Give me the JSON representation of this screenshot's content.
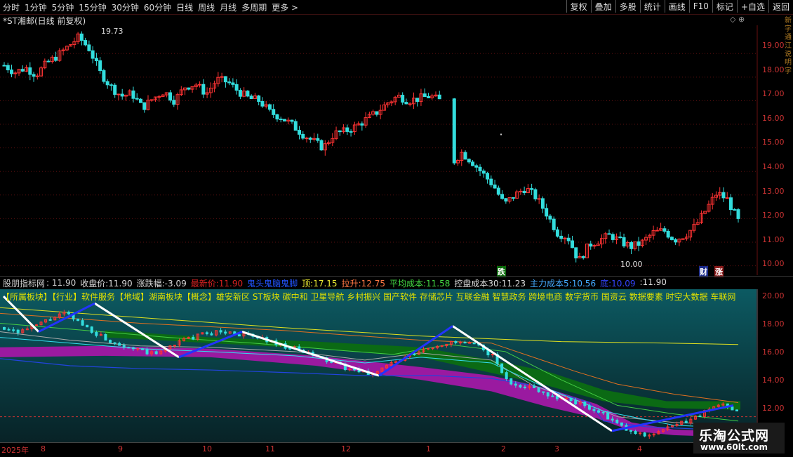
{
  "toolbar": {
    "periods": [
      "分时",
      "1分钟",
      "5分钟",
      "15分钟",
      "30分钟",
      "60分钟",
      "日线",
      "周线",
      "月线",
      "多周期",
      "更多 >"
    ],
    "active_period": "日线",
    "tools": [
      "复权",
      "叠加",
      "多股",
      "统计",
      "画线",
      "F10",
      "标记",
      "+自选",
      "返回"
    ]
  },
  "main_chart": {
    "title": "*ST湘邮(日线 前复权)",
    "high_label": "19.73",
    "low_label": "10.00",
    "y_ticks": [
      "19.00",
      "18.00",
      "17.00",
      "16.00",
      "15.00",
      "14.00",
      "13.00",
      "12.00",
      "11.00",
      "10.00"
    ],
    "markers": {
      "die": "跌",
      "cai": "财",
      "zhang": "涨"
    },
    "side_text": "新 字 通 江 说 明 字"
  },
  "indicator": {
    "name": "股朋指标网",
    "value": "11.90",
    "fields": [
      {
        "label": "收盘价:",
        "value": "11.90",
        "color": "#dddddd"
      },
      {
        "label": "涨跌幅:",
        "value": "-3.09",
        "color": "#dddddd"
      },
      {
        "label": "最新价:",
        "value": "11.90",
        "color": "#dd2222"
      },
      {
        "label": "鬼头鬼脑鬼脚",
        "value": "",
        "color": "#2255ff"
      },
      {
        "label": "顶:",
        "value": "17.15",
        "color": "#eeee33"
      },
      {
        "label": "拉升:",
        "value": "12.75",
        "color": "#ff7744"
      },
      {
        "label": "平均成本:",
        "value": "11.58",
        "color": "#44dd44"
      },
      {
        "label": "控盘成本30:",
        "value": "11.23",
        "color": "#dddddd"
      },
      {
        "label": "主力成本5:",
        "value": "10.56",
        "color": "#44aaff"
      },
      {
        "label": "底:",
        "value": "10.09",
        "color": "#3344ff"
      },
      {
        "label": ":",
        "value": "11.90",
        "color": "#dddddd"
      }
    ],
    "concepts": "【所属板块】【行业】软件服务【地域】湖南板块【概念】雄安新区 ST板块 碳中和 卫星导航 乡村振兴 国产软件 存储芯片 互联金融 智慧政务 跨境电商 数字货币 国资云 数据要素 时空大数据 车联网",
    "y_ticks": [
      "20.00",
      "18.00",
      "16.00",
      "14.00",
      "12.00"
    ]
  },
  "x_axis": [
    "2025年",
    "8",
    "9",
    "10",
    "11",
    "12",
    "1",
    "2",
    "3",
    "4"
  ],
  "brand": {
    "name": "乐淘公式网",
    "url": "www.60lt.com"
  },
  "chart_data": {
    "type": "candlestick",
    "title": "*ST湘邮(日线 前复权)",
    "ylim": [
      9.6,
      20.2
    ],
    "annotations": [
      {
        "label": "19.73"
      },
      {
        "label": "10.00"
      }
    ],
    "close_path": [
      18.5,
      18.2,
      18.4,
      18.1,
      18.6,
      18.9,
      19.3,
      19.7,
      19.2,
      18.2,
      17.6,
      17.2,
      17.3,
      16.7,
      17.1,
      17.4,
      17.0,
      17.6,
      17.7,
      17.3,
      17.9,
      17.8,
      17.4,
      17.1,
      17.0,
      16.5,
      16.3,
      16.0,
      15.6,
      15.3,
      15.0,
      15.6,
      15.7,
      15.9,
      16.2,
      16.5,
      16.9,
      17.2,
      17.0,
      17.1,
      17.2,
      17.0,
      14.3,
      14.8,
      14.4,
      13.9,
      13.4,
      12.6,
      13.0,
      13.3,
      12.9,
      12.2,
      11.4,
      11.2,
      10.2,
      10.9,
      11.1,
      11.3,
      11.0,
      10.8,
      11.0,
      11.4,
      11.5,
      11.1,
      11.3,
      11.7,
      12.4,
      13.1,
      12.8,
      11.9
    ],
    "indicator_band_top": [
      18.1,
      18.0,
      17.8,
      17.6,
      17.4,
      17.3,
      17.2,
      17.0,
      16.8,
      16.6,
      16.4,
      16.2,
      16.0,
      15.6,
      15.0,
      14.4,
      13.8,
      13.3,
      13.1,
      13.0,
      13.0
    ],
    "trend_lines": "white falling segments / blue rising segments"
  }
}
